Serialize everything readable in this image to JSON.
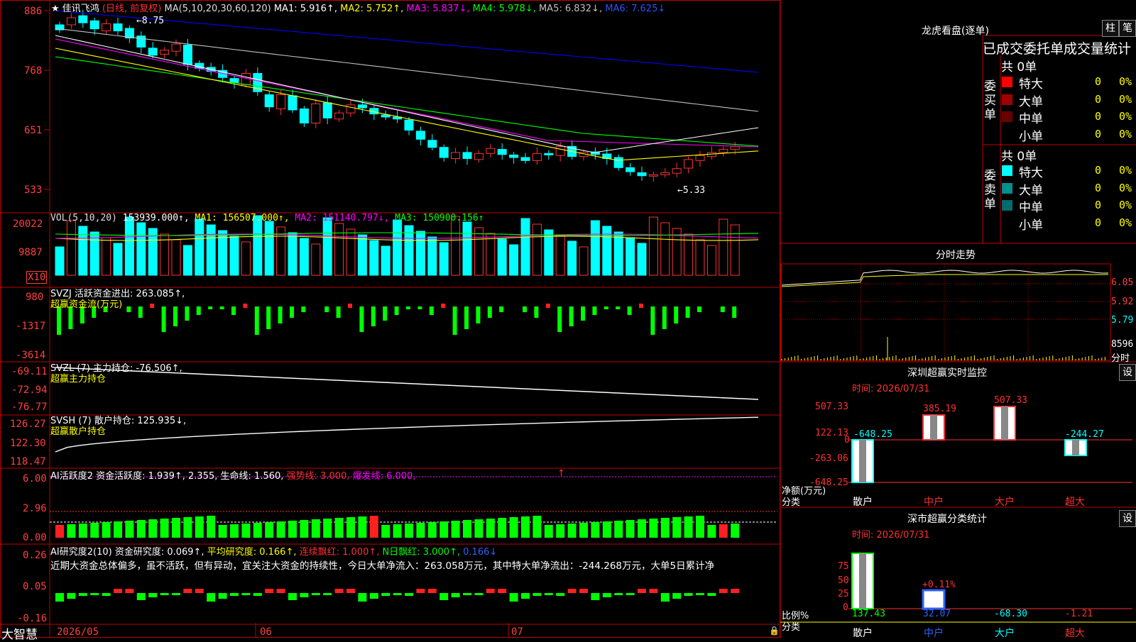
{
  "colors": {
    "up": "#ff3232",
    "down": "#00ffff",
    "vol_up": "#ff3232",
    "grid": "#b00000",
    "axis": "#ff4040",
    "ma1": "#ffffff",
    "ma2": "#ffff00",
    "ma3": "#ff00ff",
    "ma4": "#00ff00",
    "ma5": "#c0c0c0",
    "ma6": "#0000ff",
    "bright_green": "#00ff00"
  },
  "main": {
    "star": "★",
    "stock_name": "佳讯飞鸿",
    "period": "(日线, 前复权)",
    "ma_title": "MA(5,10,20,30,60,120)",
    "ma1": "MA1: 5.916↑,",
    "ma2": "MA2: 5.752↑,",
    "ma3": "MA3: 5.837↓,",
    "ma4": "MA4: 5.978↓,",
    "ma5": "MA5: 6.832↓,",
    "ma6": "MA6: 7.625↓",
    "high_label": "8.75",
    "low_label": "5.33",
    "y_ticks": [
      "886",
      "768",
      "651",
      "533"
    ]
  },
  "vol": {
    "title": "VOL(5,10,20)",
    "value": "153939.000↑,",
    "ma1": "MA1: 156507.000↑,",
    "ma2": "MA2: 151140.797↓,",
    "ma3": "MA3: 150900.156↑",
    "y_ticks": [
      "20022",
      "9887"
    ],
    "unit": "X10"
  },
  "svzj": {
    "title": "SVZJ  活跃资金进出: 263.085↑,",
    "subtitle": "超赢资金流(万元)",
    "y_ticks": [
      "980",
      "-1317",
      "-3614"
    ]
  },
  "svzl": {
    "title": "SVZL (7) 主力持仓: -76.506↑,",
    "subtitle": "超赢主力持仓",
    "y_ticks": [
      "-69.11",
      "-72.94",
      "-76.77"
    ]
  },
  "svsh": {
    "title": "SVSH (7) 散户持仓: 125.935↓,",
    "subtitle": "超赢散户持仓",
    "y_ticks": [
      "126.27",
      "122.30",
      "118.47"
    ]
  },
  "ai1": {
    "prefix": "AI活跃度2 资金活跃度: 1.939↑,",
    "v2": "2.355,",
    "v3": "生命线: 1.560,",
    "v4": "强势线: 3.000,",
    "v5": "爆发线: 6.000,",
    "arrow": "↑",
    "y_ticks": [
      "6.00",
      "2.96",
      "0.00"
    ]
  },
  "ai2": {
    "prefix": "AI研究度2(10) 资金研究度: 0.069↑,",
    "v2": "平均研究度: 0.166↑,",
    "v3": "连续飘红: 1.000↑,",
    "v4": "N日飘红: 3.000↑,",
    "v5": "0.166↓",
    "comment": "近期大资金总体偏多，虽不活跃，但有异动，宜关注大资金的持续性，今日大单净流入：263.058万元，其中特大单净流出：-244.268万元，大单5日累计净",
    "y_ticks": [
      "0.26",
      "0.05",
      "-0.16"
    ]
  },
  "footer": {
    "brand": "大智慧",
    "dates": [
      "2026/05",
      "06",
      "07"
    ]
  },
  "right": {
    "longhu_title": "龙虎看盘(逐单)",
    "tab_zhu": "柱",
    "tab_bi": "笔",
    "stats_title": "已成交委托单成交量统计",
    "buy_label": "委买单",
    "sell_label": "委卖单",
    "buy_total": "共 0单",
    "sell_total": "共 0单",
    "buy_rows": [
      {
        "name": "特大",
        "count": "0",
        "pct": "0%",
        "color": "#ff0000"
      },
      {
        "name": "大单",
        "count": "0",
        "pct": "0%",
        "color": "#a00000"
      },
      {
        "name": "中单",
        "count": "0",
        "pct": "0%",
        "color": "#6a0000"
      },
      {
        "name": "小单",
        "count": "0",
        "pct": "0%",
        "color": ""
      }
    ],
    "sell_rows": [
      {
        "name": "特大",
        "count": "0",
        "pct": "0%",
        "color": "#00ffff"
      },
      {
        "name": "大单",
        "count": "0",
        "pct": "0%",
        "color": "#008f8f"
      },
      {
        "name": "中单",
        "count": "0",
        "pct": "0%",
        "color": "#006b6b"
      },
      {
        "name": "小单",
        "count": "0",
        "pct": "0%",
        "color": ""
      }
    ],
    "intraday_title": "分时走势",
    "intraday_ticks": [
      "6.05",
      "5.92",
      "5.79",
      "8596"
    ],
    "intraday_unit": "分时",
    "sz_title": "深圳超赢实时监控",
    "sz_set": "设",
    "time_label": "时间: 2026/07/31",
    "sz_y_ticks": [
      "507.33",
      "122.13",
      "0",
      "-263.06",
      "-648.25"
    ],
    "sz_bar_labels": [
      "-648.25",
      "385.19",
      "507.33",
      "-244.27"
    ],
    "sz_net_label": "净额(万元)",
    "sz_cat_label": "分类",
    "categories": [
      "散户",
      "中户",
      "大户",
      "超大"
    ],
    "sc_title": "深市超赢分类统计",
    "sc_set": "设",
    "sc_time_label": "时间: 2026/07/31",
    "sc_y_ticks": [
      "75",
      "50",
      "25",
      "0"
    ],
    "sc_bar_label": "+0.11%",
    "sc_values": [
      "137.43",
      "32.07",
      "-68.30",
      "-1.21"
    ],
    "sc_ratio_label": "比例%",
    "sc_cat_label": "分类"
  },
  "chart_data": {
    "type": "candlestick",
    "ylim": [
      533,
      886
    ],
    "high": 8.75,
    "low": 5.33,
    "ma_last": {
      "MA1": 5.916,
      "MA2": 5.752,
      "MA3": 5.837,
      "MA4": 5.978,
      "MA5": 6.832,
      "MA6": 7.625
    },
    "sz_net": {
      "categories": [
        "散户",
        "中户",
        "大户",
        "超大"
      ],
      "values": [
        -648.25,
        385.19,
        507.33,
        -244.27
      ]
    },
    "sc_ratio": {
      "categories": [
        "散户",
        "中户",
        "大户",
        "超大"
      ],
      "values": [
        137.43,
        32.07,
        -68.3,
        -1.21
      ]
    }
  }
}
